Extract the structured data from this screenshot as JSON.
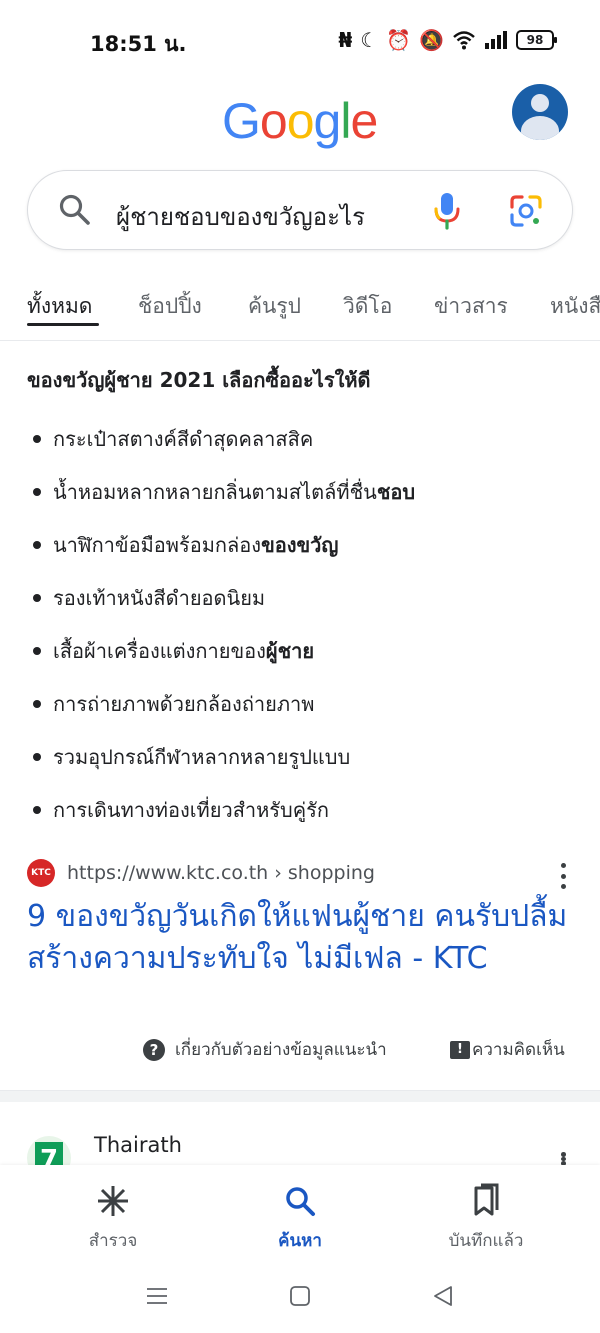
{
  "status_bar": {
    "time": "18:51 น.",
    "battery": "98",
    "icons": [
      "nfc-icon",
      "moon-icon",
      "alarm-icon",
      "mute-icon",
      "wifi-icon",
      "signal-icon",
      "battery-icon"
    ]
  },
  "header": {
    "logo_letters": [
      {
        "char": "G",
        "color": "#4285F4"
      },
      {
        "char": "o",
        "color": "#EA4335"
      },
      {
        "char": "o",
        "color": "#FBBC05"
      },
      {
        "char": "g",
        "color": "#4285F4"
      },
      {
        "char": "l",
        "color": "#34A853"
      },
      {
        "char": "e",
        "color": "#EA4335"
      }
    ],
    "avatar_color": "#1a5fa8"
  },
  "search": {
    "query": "ผู้ชายชอบของขวัญอะไร"
  },
  "tabs": [
    {
      "label": "ทั้งหมด",
      "active": true
    },
    {
      "label": "ช็อปปิ้ง",
      "active": false
    },
    {
      "label": "ค้นรูป",
      "active": false
    },
    {
      "label": "วิดีโอ",
      "active": false
    },
    {
      "label": "ข่าวสาร",
      "active": false
    },
    {
      "label": "หนังสือ",
      "active": false
    }
  ],
  "snippet": {
    "heading": "ของขวัญผู้ชาย 2021 เลือกซื้ออะไรให้ดี",
    "items": [
      {
        "text": "กระเป๋าสตางค์สีดำสุดคลาสสิค",
        "bold": ""
      },
      {
        "text": "น้ำหอมหลากหลายกลิ่นตามสไตล์ที่ชื่น",
        "bold": "ชอบ"
      },
      {
        "text": "นาฬิกาข้อมือพร้อมกล่อง",
        "bold": "ของขวัญ"
      },
      {
        "text": "รองเท้าหนังสีดำยอดนิยม",
        "bold": ""
      },
      {
        "text": "เสื้อผ้าเครื่องแต่งกายของ",
        "bold": "ผู้ชาย"
      },
      {
        "text": "การถ่ายภาพด้วยกล้องถ่ายภาพ",
        "bold": ""
      },
      {
        "text": "รวมอุปกรณ์กีฬาหลากหลายรูปแบบ",
        "bold": ""
      },
      {
        "text": "การเดินทางท่องเที่ยวสำหรับคู่รัก",
        "bold": ""
      }
    ]
  },
  "result": {
    "favicon_text": "KTC",
    "url": "https://www.ktc.co.th › shopping",
    "title": "9 ของขวัญวันเกิดให้แฟนผู้ชาย คนรับปลื้ม สร้างความประทับใจ ไม่มีเฟล - KTC",
    "about_label": "เกี่ยวกับตัวอย่างข้อมูลแนะนำ",
    "feedback_label": "ความคิดเห็น",
    "link_color": "#1a57c2"
  },
  "next_result": {
    "source": "Thairath"
  },
  "bottom_nav": [
    {
      "label": "สำรวจ",
      "icon": "asterisk-icon",
      "active": false
    },
    {
      "label": "ค้นหา",
      "icon": "search-icon",
      "active": true
    },
    {
      "label": "บันทึกแล้ว",
      "icon": "bookmark-icon",
      "active": false
    }
  ]
}
